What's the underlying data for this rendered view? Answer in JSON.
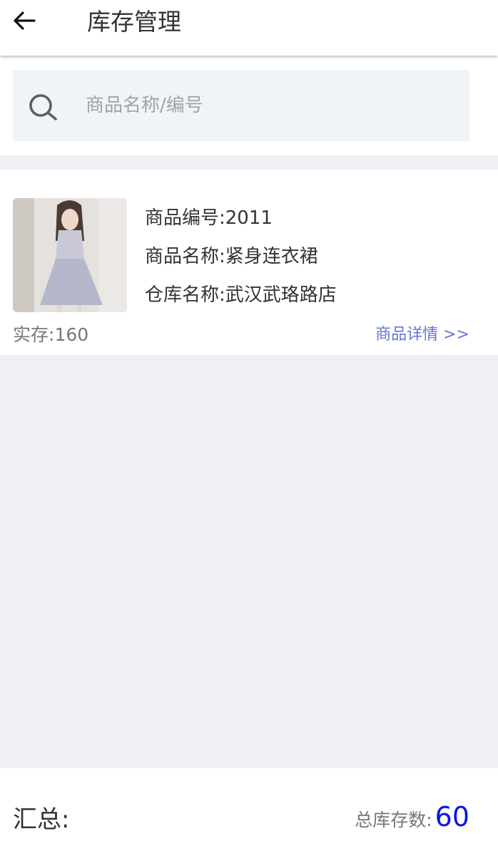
{
  "header": {
    "back_icon": "arrow-left-icon",
    "title": "库存管理"
  },
  "search": {
    "icon": "search-icon",
    "placeholder": "商品名称/编号",
    "value": ""
  },
  "products": [
    {
      "code_label": "商品编号:",
      "code": "2011",
      "name_label": "商品名称:",
      "name": "紧身连衣裙",
      "warehouse_label": "仓库名称:",
      "warehouse": "武汉武珞路店",
      "stock_label": "实存:",
      "stock": "160",
      "detail_link": "商品详情 >>"
    }
  ],
  "summary": {
    "label": "汇总:",
    "total_label": "总库存数:",
    "total_value": "60"
  },
  "colors": {
    "accent_link": "#6a72d8",
    "total_value": "#0a14e6",
    "background": "#efeff4"
  }
}
